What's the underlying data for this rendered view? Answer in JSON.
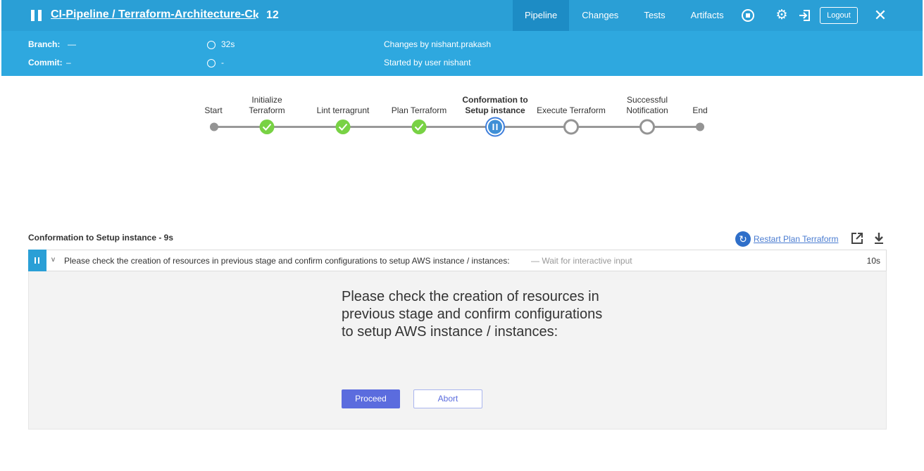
{
  "header": {
    "title": "CI-Pipeline / Terraform-Architecture-CI",
    "run_chevron": "‹",
    "run_number": "12",
    "tabs": [
      {
        "label": "Pipeline",
        "active": true
      },
      {
        "label": "Changes",
        "active": false
      },
      {
        "label": "Tests",
        "active": false
      },
      {
        "label": "Artifacts",
        "active": false
      }
    ],
    "logout_label": "Logout",
    "close_glyph": "✕",
    "gear_glyph": "⚙"
  },
  "info": {
    "branch_label": "Branch:",
    "branch_value": "—",
    "commit_label": "Commit:",
    "commit_value": "–",
    "duration": "32s",
    "started": "-",
    "changes_by": "Changes by nishant.prakash",
    "started_by": "Started by user nishant"
  },
  "pipeline": {
    "stages": [
      {
        "label_lines": [
          "Start"
        ],
        "state": "start",
        "bold": false
      },
      {
        "label_lines": [
          "Initialize",
          "Terraform"
        ],
        "state": "success",
        "bold": false
      },
      {
        "label_lines": [
          "Lint terragrunt"
        ],
        "state": "success",
        "bold": false
      },
      {
        "label_lines": [
          "Plan Terraform"
        ],
        "state": "success",
        "bold": false
      },
      {
        "label_lines": [
          "Conformation to",
          "Setup instance"
        ],
        "state": "paused",
        "bold": true
      },
      {
        "label_lines": [
          "Execute Terraform"
        ],
        "state": "not_built",
        "bold": false
      },
      {
        "label_lines": [
          "Successful",
          "Notification"
        ],
        "state": "not_built",
        "bold": false
      },
      {
        "label_lines": [
          "End"
        ],
        "state": "end",
        "bold": false
      }
    ]
  },
  "log": {
    "title": "Conformation to Setup instance - 9s",
    "restart_label": "Restart Plan Terraform",
    "restart_glyph": "↻",
    "step": {
      "chevron": "v",
      "message": "Please check the creation of resources in previous stage and confirm configurations to setup AWS instance / instances:",
      "wait_text": "— Wait for interactive input",
      "duration": "10s"
    },
    "input": {
      "prompt": "Please check the creation of resources in previous stage and confirm configurations to setup AWS instance / instances:",
      "proceed_label": "Proceed",
      "abort_label": "Abort"
    }
  },
  "colors": {
    "topbar": "#2a9fd6",
    "infobar": "#2ea8df",
    "success": "#78d244",
    "paused": "#3f7fdc",
    "proceed": "#5b6cde"
  }
}
